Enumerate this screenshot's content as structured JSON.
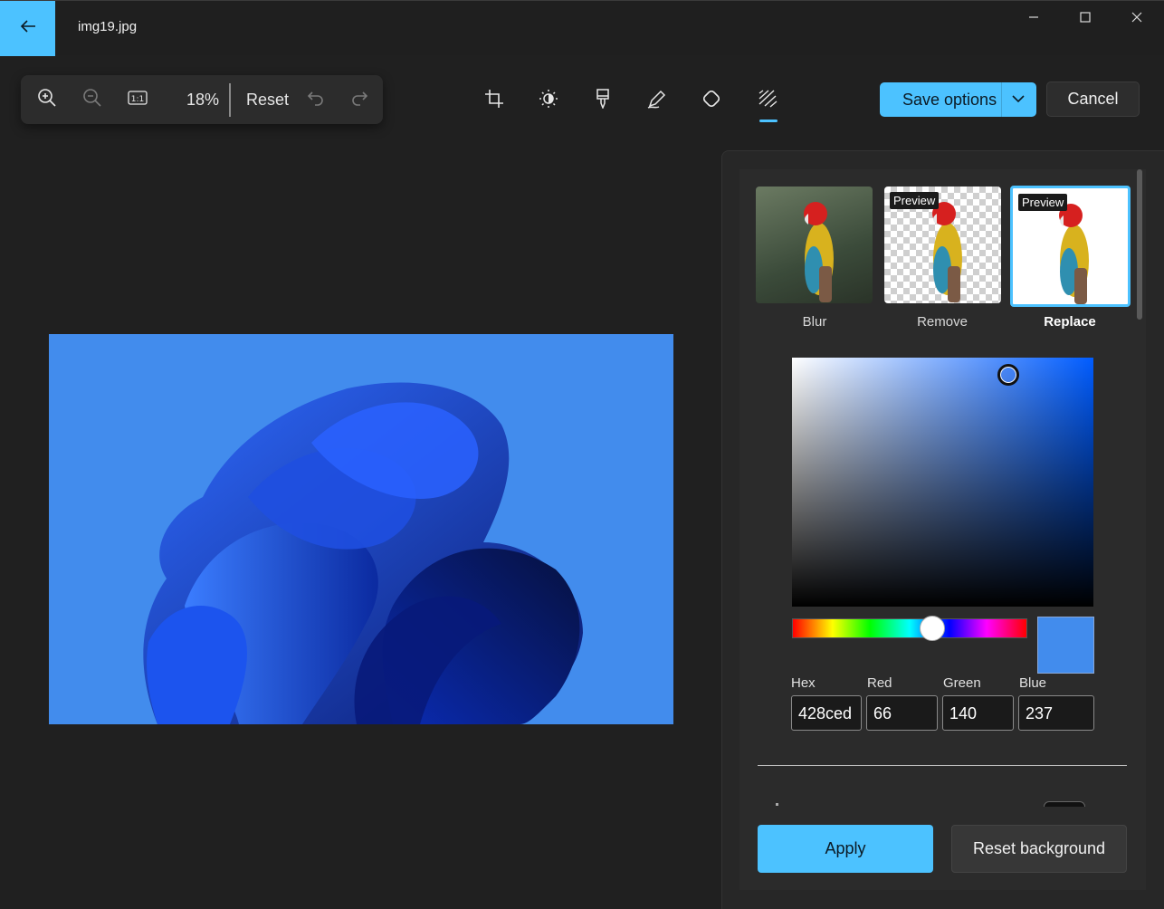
{
  "window": {
    "title": "img19.jpg"
  },
  "zoom": {
    "percent": "18%",
    "reset_label": "Reset"
  },
  "tools": [
    "crop-icon",
    "brightness-icon",
    "filter-brush-icon",
    "markup-pen-icon",
    "retouch-icon",
    "background-icon"
  ],
  "actions": {
    "save_label": "Save options",
    "cancel_label": "Cancel"
  },
  "background": {
    "options": [
      {
        "label": "Blur",
        "badge": ""
      },
      {
        "label": "Remove",
        "badge": "Preview"
      },
      {
        "label": "Replace",
        "badge": "Preview"
      }
    ],
    "selected": "Replace"
  },
  "color": {
    "hex_label": "Hex",
    "red_label": "Red",
    "green_label": "Green",
    "blue_label": "Blue",
    "hex": "428ced",
    "red": "66",
    "green": "140",
    "blue": "237",
    "swatch": "#428ced"
  },
  "footer": {
    "apply_label": "Apply",
    "reset_background_label": "Reset background"
  },
  "colors": {
    "accent": "#4cc2ff",
    "canvas_bg": "#428ced"
  }
}
